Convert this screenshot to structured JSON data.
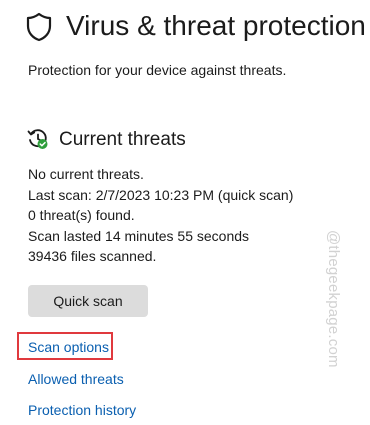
{
  "header": {
    "title": "Virus & threat protection",
    "subtitle": "Protection for your device against threats."
  },
  "current_threats": {
    "heading": "Current threats",
    "status_lines": [
      "No current threats.",
      "Last scan: 2/7/2023 10:23 PM (quick scan)",
      "0 threat(s) found.",
      "Scan lasted 14 minutes 55 seconds",
      "39436 files scanned."
    ],
    "quick_scan_label": "Quick scan"
  },
  "links": {
    "scan_options": "Scan options",
    "allowed_threats": "Allowed threats",
    "protection_history": "Protection history"
  },
  "watermark": "@thegeekpage.com",
  "icons": {
    "header": "shield-icon",
    "section": "threats-history-icon",
    "status": "check-badge-icon"
  },
  "colors": {
    "link": "#0a5fb0",
    "highlight_border": "#e0393e",
    "button_bg": "#dcdcdc",
    "status_ok": "#2e9e3b"
  }
}
